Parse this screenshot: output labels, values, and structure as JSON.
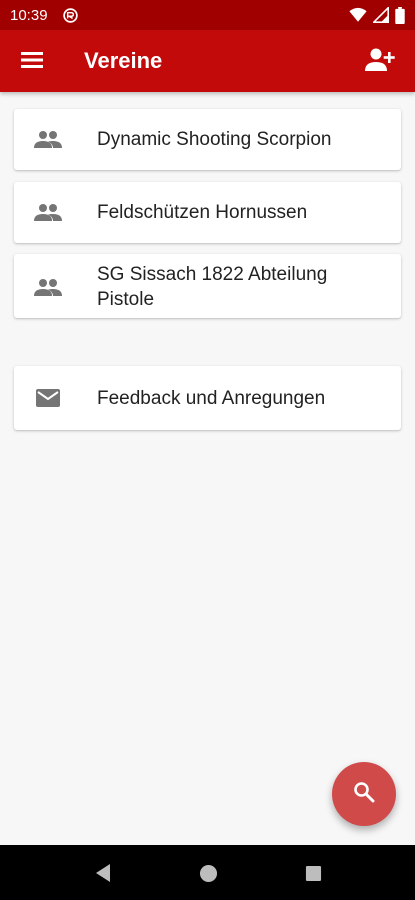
{
  "status_bar": {
    "time": "10:39",
    "icons": [
      "sync-circle-icon",
      "wifi-icon",
      "cell-signal-icon",
      "battery-icon"
    ]
  },
  "app_bar": {
    "title": "Vereine",
    "menu_icon": "menu-icon",
    "action_icon": "add-person-icon"
  },
  "clubs": [
    {
      "name": "Dynamic Shooting Scorpion",
      "icon": "group-icon"
    },
    {
      "name": "Feldschützen Hornussen",
      "icon": "group-icon"
    },
    {
      "name": "SG Sissach 1822 Abteilung Pistole",
      "icon": "group-icon"
    }
  ],
  "feedback": {
    "label": "Feedback und Anregungen",
    "icon": "mail-icon"
  },
  "fab": {
    "icon": "search-icon"
  },
  "nav_bar": {
    "icons": [
      "back-icon",
      "home-icon",
      "recents-icon"
    ]
  },
  "colors": {
    "status_bar": "#a10000",
    "app_bar": "#c20a0a",
    "fab": "#d04a4a",
    "background": "#f7f7f7"
  }
}
